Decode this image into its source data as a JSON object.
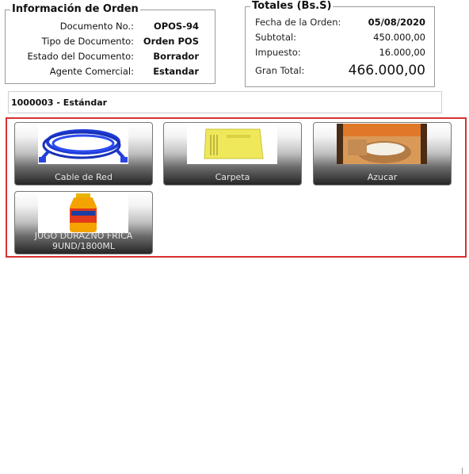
{
  "orden": {
    "title": "Información de Orden",
    "fields": [
      {
        "label": "Documento No.:",
        "value": "OPOS-94"
      },
      {
        "label": "Tipo de Documento:",
        "value": "Orden POS"
      },
      {
        "label": "Estado del Documento:",
        "value": "Borrador"
      },
      {
        "label": "Agente Comercial:",
        "value": "Estandar"
      }
    ]
  },
  "totales": {
    "title": "Totales (Bs.S)",
    "fecha_label": "Fecha de la Orden:",
    "fecha_value": "05/08/2020",
    "subtotal_label": "Subtotal:",
    "subtotal_value": "450.000,00",
    "impuesto_label": "Impuesto:",
    "impuesto_value": "16.000,00",
    "gran_total_label": "Gran Total:",
    "gran_total_value": "466.000,00"
  },
  "pricelist": {
    "label": "1000003 - Estándar"
  },
  "products": [
    {
      "name": "Cable de Red",
      "icon": "network-cable-image"
    },
    {
      "name": "Carpeta",
      "icon": "folder-image"
    },
    {
      "name": "Azucar",
      "icon": "sugar-bag-image"
    },
    {
      "name": "JUGO DURAZNO FRICA 9UND/1800ML",
      "icon": "juice-bottle-image"
    }
  ],
  "colors": {
    "panel_border": "#d83030"
  }
}
